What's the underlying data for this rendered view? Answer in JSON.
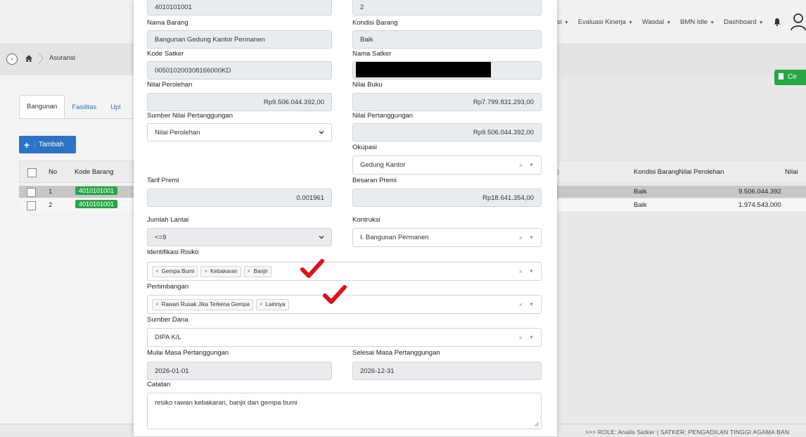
{
  "topnav": {
    "items": [
      {
        "label": "si",
        "caret": true
      },
      {
        "label": "Evaluasi Kinerja",
        "caret": true
      },
      {
        "label": "Wasdal",
        "caret": true
      },
      {
        "label": "BMN Idle",
        "caret": true
      },
      {
        "label": "Dashboard",
        "caret": true
      }
    ]
  },
  "breadcrumb": {
    "back_icon": "chevron-left-icon",
    "home_icon": "home-icon",
    "current": "Asuransi"
  },
  "right_button": {
    "label": "Ce"
  },
  "tabs": [
    {
      "label": "Bangunan",
      "active": true
    },
    {
      "label": "Fasilitas",
      "active": false
    },
    {
      "label": "Upl",
      "active": false
    }
  ],
  "add_button": {
    "label": "Tambah",
    "icon": "+"
  },
  "table": {
    "left_headers": [
      "No",
      "Kode Barang"
    ],
    "right_headers": [
      "Kondisi Barang",
      "Nilai Perolehan",
      "Nilai"
    ],
    "rows": [
      {
        "no": "1",
        "kode": "4010101001",
        "kondisi": "Baik",
        "nilai_perolehan": "9.506.044.392"
      },
      {
        "no": "2",
        "kode": "4010101001",
        "kondisi": "Baik",
        "nilai_perolehan": "1.974.543.000"
      }
    ]
  },
  "footer": {
    "text": ">>>  ROLE: Analis Satker |  SATKER: PENGADILAN TINGGI AGAMA BAN"
  },
  "modal": {
    "kode_barang_value": "4010101001",
    "nup_value": "2",
    "nama_barang": {
      "label": "Nama Barang",
      "value": "Bangunan Gedung Kantor Permanen"
    },
    "kondisi_barang": {
      "label": "Kondisi Barang",
      "value": "Baik"
    },
    "kode_satker": {
      "label": "Kode Satker",
      "value": "005010200308166000KD"
    },
    "nama_satker": {
      "label": "Nama Satker",
      "value": ""
    },
    "nilai_perolehan": {
      "label": "Nilai Perolehan",
      "value": "Rp9.506.044.392,00"
    },
    "nilai_buku": {
      "label": "Nilai Buku",
      "value": "Rp7.799.831.293,00"
    },
    "sumber_nilai": {
      "label": "Sumber Nilai Pertanggungan",
      "value": "Nilai Perolehan"
    },
    "nilai_pertanggungan": {
      "label": "Nilai Pertanggungan",
      "value": "Rp9.506.044.392,00"
    },
    "okupasi": {
      "label": "Okupasi",
      "value": "Gedung Kantor"
    },
    "tarif_premi": {
      "label": "Tarif Premi",
      "value": "0.001961"
    },
    "besaran_premi": {
      "label": "Besaran Premi",
      "value": "Rp18.641.354,00"
    },
    "jumlah_lantai": {
      "label": "Jumlah Lantai",
      "value": "<=9"
    },
    "kontruksi": {
      "label": "Kontruksi",
      "value": "I. Bangunan Permanen"
    },
    "identifikasi_risiko": {
      "label": "Identifikasi Risiko",
      "tags": [
        "Gempa Bumi",
        "Kebakaran",
        "Banjir"
      ]
    },
    "pertimbangan": {
      "label": "Pertimbangan",
      "tags": [
        "Rawan Rusak Jika Terkena Gempa",
        "Lainnya"
      ]
    },
    "sumber_dana": {
      "label": "Sumber Dana",
      "value": "DIPA K/L"
    },
    "mulai_masa": {
      "label": "Mulai Masa Pertanggungan",
      "value": "2026-01-01"
    },
    "selesai_masa": {
      "label": "Selesai Masa Pertanggungan",
      "value": "2026-12-31"
    },
    "catatan": {
      "label": "Catatan",
      "value": "resiko rawan kebakaran, banjir dan gempa bumi"
    },
    "clear_symbol": "×",
    "caret_symbol": "▼"
  },
  "colors": {
    "primary": "#2c73c4",
    "success": "#28a745",
    "annotation_red": "#e0101a"
  }
}
